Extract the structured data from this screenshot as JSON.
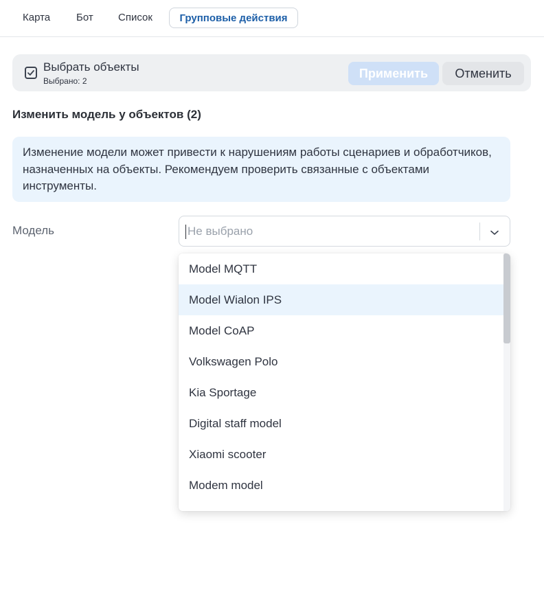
{
  "tabs": [
    {
      "label": "Карта"
    },
    {
      "label": "Бот"
    },
    {
      "label": "Список"
    },
    {
      "label": "Групповые действия",
      "active": true
    }
  ],
  "selection": {
    "title": "Выбрать объекты",
    "count": "Выбрано: 2",
    "apply_label": "Применить",
    "cancel_label": "Отменить"
  },
  "section_title": "Изменить модель у объектов (2)",
  "notice": "Изменение модели может привести к нарушениям работы сценариев и обработчиков, назначенных на объекты. Рекомендуем проверить связанные с объектами инструменты.",
  "model_field": {
    "label": "Модель",
    "placeholder": "Не выбрано",
    "options": [
      "Model MQTT",
      "Model Wialon IPS",
      "Model CoAP",
      "Volkswagen Polo",
      "Kia Sportage",
      "Digital staff model",
      "Xiaomi scooter",
      "Modem model"
    ],
    "highlighted_index": 1
  },
  "colors": {
    "accent": "#1d5fa8",
    "notice_bg": "#eaf4fd",
    "apply_disabled_bg": "#cfe0f7"
  },
  "icons": [
    "checkbox-checked-icon",
    "chevron-down-icon"
  ]
}
